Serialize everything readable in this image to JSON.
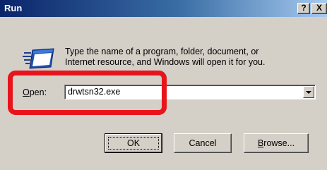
{
  "window": {
    "title": "Run",
    "help_button": "?",
    "close_button": "X"
  },
  "description": {
    "line1": "Type the name of a program, folder, document, or",
    "line2": "Internet resource, and Windows will open it for you."
  },
  "open_field": {
    "label_accel": "O",
    "label_rest": "pen:",
    "value": "drwtsn32.exe"
  },
  "buttons": {
    "ok": "OK",
    "cancel": "Cancel",
    "browse_accel": "B",
    "browse_rest": "rowse..."
  },
  "icons": {
    "run": "run-dialog-icon",
    "dropdown": "chevron-down-icon"
  },
  "colors": {
    "highlight": "#e8141b",
    "titlebar": "#0a246a"
  }
}
